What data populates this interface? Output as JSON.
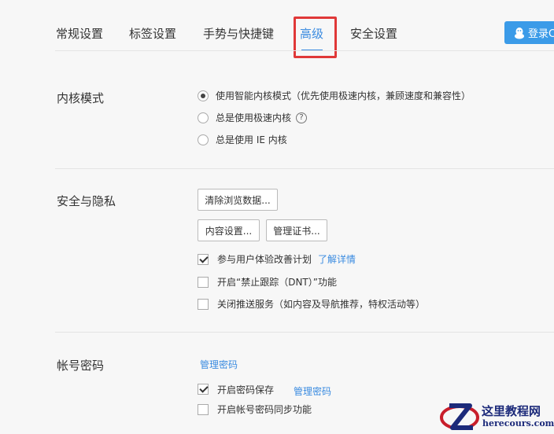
{
  "tabs": [
    {
      "label": "常规设置"
    },
    {
      "label": "标签设置"
    },
    {
      "label": "手势与快捷键"
    },
    {
      "label": "高级"
    },
    {
      "label": "安全设置"
    }
  ],
  "login_button": "登录C",
  "kernel": {
    "title": "内核模式",
    "options": [
      {
        "label": "使用智能内核模式（优先使用极速内核，兼顾速度和兼容性）",
        "checked": true
      },
      {
        "label": "总是使用极速内核",
        "checked": false
      },
      {
        "label": "总是使用 IE 内核",
        "checked": false
      }
    ],
    "help_glyph": "?"
  },
  "privacy": {
    "title": "安全与隐私",
    "clear_button": "清除浏览数据...",
    "content_button": "内容设置...",
    "cert_button": "管理证书...",
    "checks": [
      {
        "label": "参与用户体验改善计划",
        "checked": true,
        "link": "了解详情"
      },
      {
        "label": "开启“禁止跟踪（DNT）”功能",
        "checked": false
      },
      {
        "label": "关闭推送服务（如内容及导航推荐，特权活动等）",
        "checked": false
      }
    ]
  },
  "account": {
    "title": "帐号密码",
    "manage_link": "管理密码",
    "checks": [
      {
        "label": "开启密码保存",
        "checked": true,
        "link": "管理密码"
      },
      {
        "label": "开启帐号密码同步功能",
        "checked": false
      }
    ]
  },
  "watermark": {
    "line1": "这里教程网",
    "line2": "herecours.com"
  }
}
